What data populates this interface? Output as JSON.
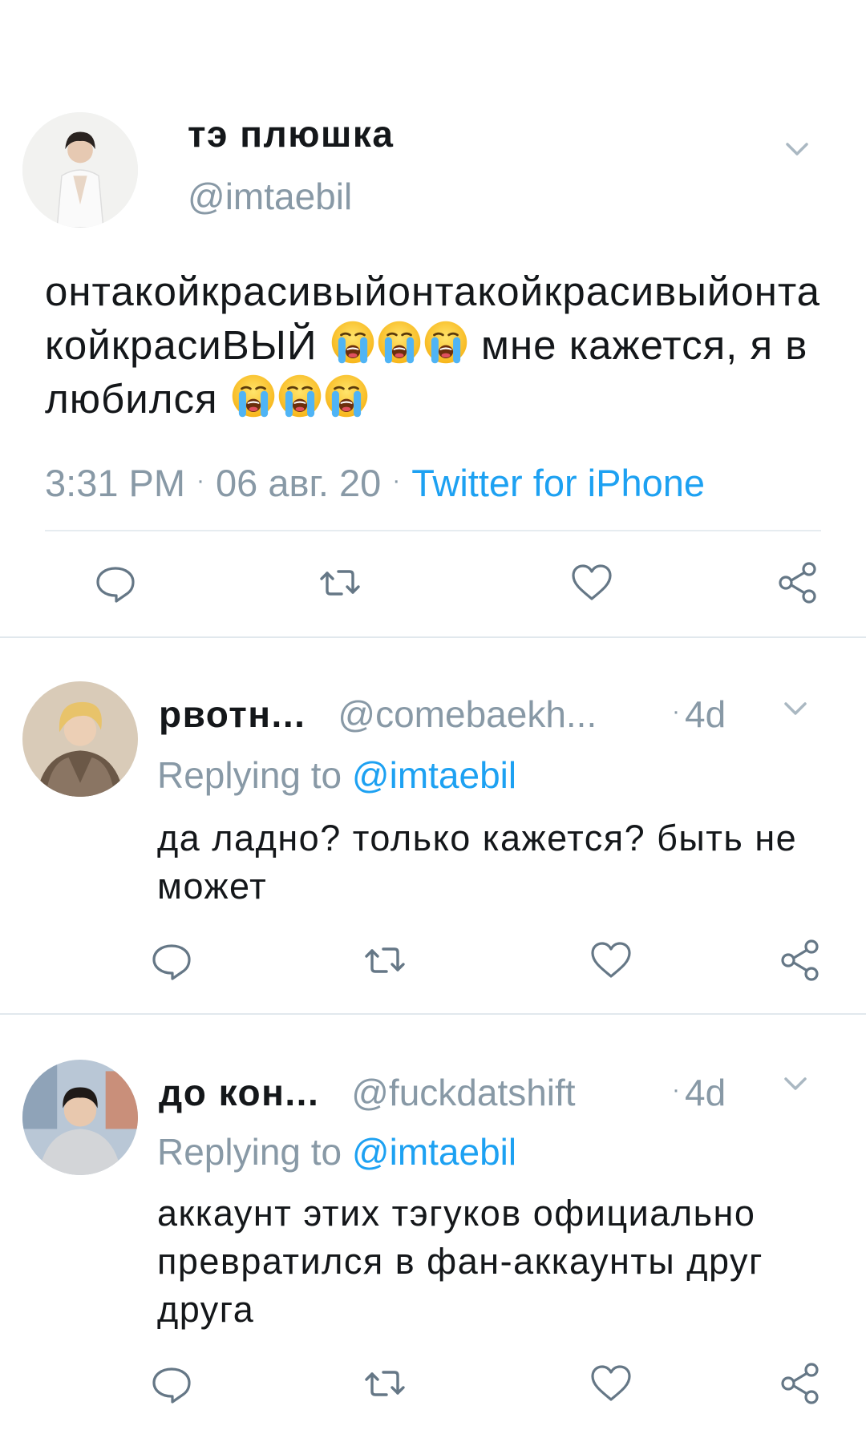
{
  "main_tweet": {
    "display_name": "тэ плюшка",
    "handle": "@imtaebil",
    "text_part1": "онтакойкрасивыйонтакойкрасивыйонтакойкрасиВЫЙ ",
    "text_part2": " мне кажется, я влюбился ",
    "emoji_name": "loudly-crying-face-emoji",
    "time": "3:31 PM",
    "date": "06 авг. 20",
    "separator": "·",
    "source": "Twitter for iPhone"
  },
  "replies": [
    {
      "display_name": "рвотн...",
      "handle": "@comebaekh...",
      "separator": "·",
      "time": "4d",
      "replying_label": "Replying to ",
      "replying_to": "@imtaebil",
      "text": "да ладно? только кажется? быть не может"
    },
    {
      "display_name": "до кон...",
      "handle": "@fuckdatshift",
      "separator": "·",
      "time": "4d",
      "replying_label": "Replying to ",
      "replying_to": "@imtaebil",
      "text": "аккаунт этих тэгуков официально превратился в фан-аккаунты друг друга"
    }
  ],
  "icons": [
    "reply-icon",
    "retweet-icon",
    "like-icon",
    "share-icon",
    "chevron-down-icon"
  ],
  "colors": {
    "text": "#14171a",
    "secondary": "#8899a6",
    "link": "#1da1f2",
    "divider": "#e6ecf0",
    "icon": "#657786"
  }
}
